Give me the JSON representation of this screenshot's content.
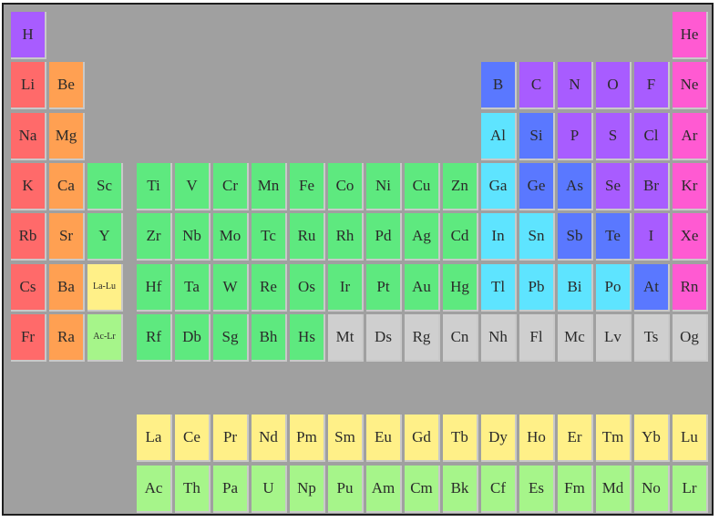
{
  "colors": {
    "alkali-metal": "#ff6a6a",
    "alkaline-earth": "#ffa052",
    "transition-metal": "#5ee97f",
    "post-transition": "#5ee4ff",
    "metalloid": "#5a78ff",
    "reactive-nonmetal": "#a85cff",
    "noble-gas": "#ff5ad2",
    "lanthanide": "#fff088",
    "actinide": "#a6f58a",
    "unknown": "#cfcfcf"
  },
  "elements": [
    {
      "symbol": "H",
      "category": "reactive-nonmetal"
    },
    {
      "symbol": "He",
      "category": "noble-gas"
    },
    {
      "symbol": "Li",
      "category": "alkali-metal"
    },
    {
      "symbol": "Be",
      "category": "alkaline-earth"
    },
    {
      "symbol": "B",
      "category": "metalloid"
    },
    {
      "symbol": "C",
      "category": "reactive-nonmetal"
    },
    {
      "symbol": "N",
      "category": "reactive-nonmetal"
    },
    {
      "symbol": "O",
      "category": "reactive-nonmetal"
    },
    {
      "symbol": "F",
      "category": "reactive-nonmetal"
    },
    {
      "symbol": "Ne",
      "category": "noble-gas"
    },
    {
      "symbol": "Na",
      "category": "alkali-metal"
    },
    {
      "symbol": "Mg",
      "category": "alkaline-earth"
    },
    {
      "symbol": "Al",
      "category": "post-transition"
    },
    {
      "symbol": "Si",
      "category": "metalloid"
    },
    {
      "symbol": "P",
      "category": "reactive-nonmetal"
    },
    {
      "symbol": "S",
      "category": "reactive-nonmetal"
    },
    {
      "symbol": "Cl",
      "category": "reactive-nonmetal"
    },
    {
      "symbol": "Ar",
      "category": "noble-gas"
    },
    {
      "symbol": "K",
      "category": "alkali-metal"
    },
    {
      "symbol": "Ca",
      "category": "alkaline-earth"
    },
    {
      "symbol": "Sc",
      "category": "transition-metal"
    },
    {
      "symbol": "Ti",
      "category": "transition-metal"
    },
    {
      "symbol": "V",
      "category": "transition-metal"
    },
    {
      "symbol": "Cr",
      "category": "transition-metal"
    },
    {
      "symbol": "Mn",
      "category": "transition-metal"
    },
    {
      "symbol": "Fe",
      "category": "transition-metal"
    },
    {
      "symbol": "Co",
      "category": "transition-metal"
    },
    {
      "symbol": "Ni",
      "category": "transition-metal"
    },
    {
      "symbol": "Cu",
      "category": "transition-metal"
    },
    {
      "symbol": "Zn",
      "category": "transition-metal"
    },
    {
      "symbol": "Ga",
      "category": "post-transition"
    },
    {
      "symbol": "Ge",
      "category": "metalloid"
    },
    {
      "symbol": "As",
      "category": "metalloid"
    },
    {
      "symbol": "Se",
      "category": "reactive-nonmetal"
    },
    {
      "symbol": "Br",
      "category": "reactive-nonmetal"
    },
    {
      "symbol": "Kr",
      "category": "noble-gas"
    },
    {
      "symbol": "Rb",
      "category": "alkali-metal"
    },
    {
      "symbol": "Sr",
      "category": "alkaline-earth"
    },
    {
      "symbol": "Y",
      "category": "transition-metal"
    },
    {
      "symbol": "Zr",
      "category": "transition-metal"
    },
    {
      "symbol": "Nb",
      "category": "transition-metal"
    },
    {
      "symbol": "Mo",
      "category": "transition-metal"
    },
    {
      "symbol": "Tc",
      "category": "transition-metal"
    },
    {
      "symbol": "Ru",
      "category": "transition-metal"
    },
    {
      "symbol": "Rh",
      "category": "transition-metal"
    },
    {
      "symbol": "Pd",
      "category": "transition-metal"
    },
    {
      "symbol": "Ag",
      "category": "transition-metal"
    },
    {
      "symbol": "Cd",
      "category": "transition-metal"
    },
    {
      "symbol": "In",
      "category": "post-transition"
    },
    {
      "symbol": "Sn",
      "category": "post-transition"
    },
    {
      "symbol": "Sb",
      "category": "metalloid"
    },
    {
      "symbol": "Te",
      "category": "metalloid"
    },
    {
      "symbol": "I",
      "category": "reactive-nonmetal"
    },
    {
      "symbol": "Xe",
      "category": "noble-gas"
    },
    {
      "symbol": "Cs",
      "category": "alkali-metal"
    },
    {
      "symbol": "Ba",
      "category": "alkaline-earth"
    },
    {
      "symbol": "La-Lu",
      "category": "lanthanide"
    },
    {
      "symbol": "Hf",
      "category": "transition-metal"
    },
    {
      "symbol": "Ta",
      "category": "transition-metal"
    },
    {
      "symbol": "W",
      "category": "transition-metal"
    },
    {
      "symbol": "Re",
      "category": "transition-metal"
    },
    {
      "symbol": "Os",
      "category": "transition-metal"
    },
    {
      "symbol": "Ir",
      "category": "transition-metal"
    },
    {
      "symbol": "Pt",
      "category": "transition-metal"
    },
    {
      "symbol": "Au",
      "category": "transition-metal"
    },
    {
      "symbol": "Hg",
      "category": "transition-metal"
    },
    {
      "symbol": "Tl",
      "category": "post-transition"
    },
    {
      "symbol": "Pb",
      "category": "post-transition"
    },
    {
      "symbol": "Bi",
      "category": "post-transition"
    },
    {
      "symbol": "Po",
      "category": "post-transition"
    },
    {
      "symbol": "At",
      "category": "metalloid"
    },
    {
      "symbol": "Rn",
      "category": "noble-gas"
    },
    {
      "symbol": "Fr",
      "category": "alkali-metal"
    },
    {
      "symbol": "Ra",
      "category": "alkaline-earth"
    },
    {
      "symbol": "Ac-Lr",
      "category": "actinide"
    },
    {
      "symbol": "Rf",
      "category": "transition-metal"
    },
    {
      "symbol": "Db",
      "category": "transition-metal"
    },
    {
      "symbol": "Sg",
      "category": "transition-metal"
    },
    {
      "symbol": "Bh",
      "category": "transition-metal"
    },
    {
      "symbol": "Hs",
      "category": "transition-metal"
    },
    {
      "symbol": "Mt",
      "category": "unknown"
    },
    {
      "symbol": "Ds",
      "category": "unknown"
    },
    {
      "symbol": "Rg",
      "category": "unknown"
    },
    {
      "symbol": "Cn",
      "category": "unknown"
    },
    {
      "symbol": "Nh",
      "category": "unknown"
    },
    {
      "symbol": "Fl",
      "category": "unknown"
    },
    {
      "symbol": "Mc",
      "category": "unknown"
    },
    {
      "symbol": "Lv",
      "category": "unknown"
    },
    {
      "symbol": "Ts",
      "category": "unknown"
    },
    {
      "symbol": "Og",
      "category": "unknown"
    },
    {
      "symbol": "La",
      "category": "lanthanide"
    },
    {
      "symbol": "Ce",
      "category": "lanthanide"
    },
    {
      "symbol": "Pr",
      "category": "lanthanide"
    },
    {
      "symbol": "Nd",
      "category": "lanthanide"
    },
    {
      "symbol": "Pm",
      "category": "lanthanide"
    },
    {
      "symbol": "Sm",
      "category": "lanthanide"
    },
    {
      "symbol": "Eu",
      "category": "lanthanide"
    },
    {
      "symbol": "Gd",
      "category": "lanthanide"
    },
    {
      "symbol": "Tb",
      "category": "lanthanide"
    },
    {
      "symbol": "Dy",
      "category": "lanthanide"
    },
    {
      "symbol": "Ho",
      "category": "lanthanide"
    },
    {
      "symbol": "Er",
      "category": "lanthanide"
    },
    {
      "symbol": "Tm",
      "category": "lanthanide"
    },
    {
      "symbol": "Yb",
      "category": "lanthanide"
    },
    {
      "symbol": "Lu",
      "category": "lanthanide"
    },
    {
      "symbol": "Ac",
      "category": "actinide"
    },
    {
      "symbol": "Th",
      "category": "actinide"
    },
    {
      "symbol": "Pa",
      "category": "actinide"
    },
    {
      "symbol": "U",
      "category": "actinide"
    },
    {
      "symbol": "Np",
      "category": "actinide"
    },
    {
      "symbol": "Pu",
      "category": "actinide"
    },
    {
      "symbol": "Am",
      "category": "actinide"
    },
    {
      "symbol": "Cm",
      "category": "actinide"
    },
    {
      "symbol": "Bk",
      "category": "actinide"
    },
    {
      "symbol": "Cf",
      "category": "actinide"
    },
    {
      "symbol": "Es",
      "category": "actinide"
    },
    {
      "symbol": "Fm",
      "category": "actinide"
    },
    {
      "symbol": "Md",
      "category": "actinide"
    },
    {
      "symbol": "No",
      "category": "actinide"
    },
    {
      "symbol": "Lr",
      "category": "actinide"
    }
  ]
}
